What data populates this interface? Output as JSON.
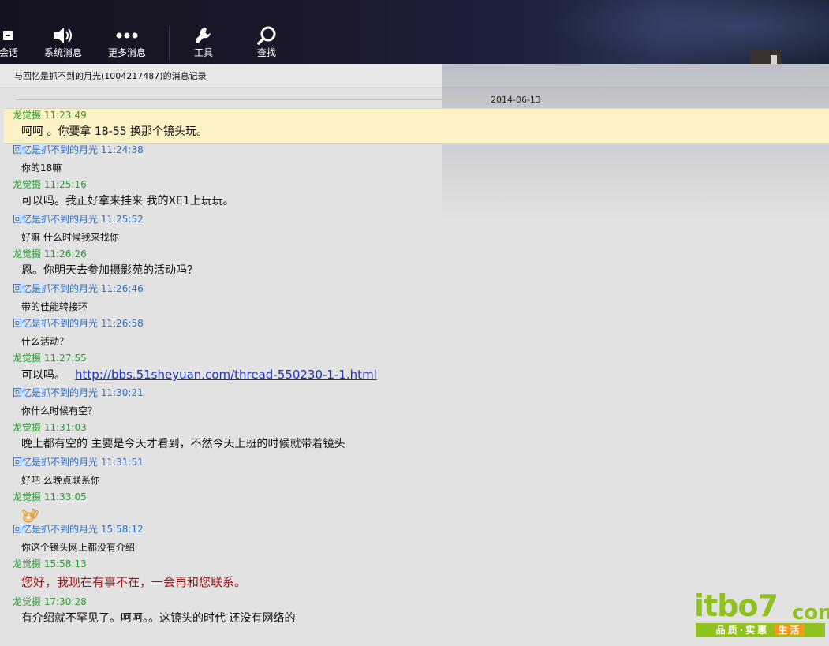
{
  "toolbar": {
    "items": [
      {
        "label": "会话",
        "icon": "chat-icon"
      },
      {
        "label": "系统消息",
        "icon": "speaker-icon"
      },
      {
        "label": "更多消息",
        "icon": "more-icon"
      },
      {
        "label": "工具",
        "icon": "wrench-icon"
      },
      {
        "label": "查找",
        "icon": "search-icon"
      }
    ]
  },
  "header": {
    "title": "与回忆是抓不到的月光(1004217487)的消息记录",
    "date": "2014-06-13"
  },
  "messages": [
    {
      "sender": "龙觉摄",
      "time": "11:23:49",
      "text": "呵呵 。你要拿 18-55 换那个镜头玩。"
    },
    {
      "sender": "回忆是抓不到的月光",
      "time": "11:24:38",
      "text": "你的18嘛"
    },
    {
      "sender": "龙觉摄",
      "time": "11:25:16",
      "text": "可以吗。我正好拿来挂来 我的XE1上玩玩。"
    },
    {
      "sender": "回忆是抓不到的月光",
      "time": "11:25:52",
      "text": "好嘛 什么时候我来找你"
    },
    {
      "sender": "龙觉摄",
      "time": "11:26:26",
      "text": "恩。你明天去参加摄影苑的活动吗？"
    },
    {
      "sender": "回忆是抓不到的月光",
      "time": "11:26:46",
      "text": "带的佳能转接环"
    },
    {
      "sender": "回忆是抓不到的月光",
      "time": "11:26:58",
      "text": "什么活动？"
    },
    {
      "sender": "龙觉摄",
      "time": "11:27:55",
      "text": "可以吗。",
      "link": "http://bbs.51sheyuan.com/thread-550230-1-1.html"
    },
    {
      "sender": "回忆是抓不到的月光",
      "time": "11:30:21",
      "text": "你什么时候有空？"
    },
    {
      "sender": "龙觉摄",
      "time": "11:31:03",
      "text": "晚上都有空的 主要是今天才看到，不然今天上班的时候就带着镜头"
    },
    {
      "sender": "回忆是抓不到的月光",
      "time": "11:31:51",
      "text": "好吧 么晚点联系你"
    },
    {
      "sender": "龙觉摄",
      "time": "11:33:05",
      "emoji": "ok-hand-emoji"
    },
    {
      "sender": "回忆是抓不到的月光",
      "time": "15:58:12",
      "text": "你这个镜头网上都没有介绍"
    },
    {
      "sender": "龙觉摄",
      "time": "15:58:13",
      "text": "您好，我现在有事不在，一会再和您联系。"
    },
    {
      "sender": "龙觉摄",
      "time": "17:30:28",
      "text": "有介绍就不罕见了。呵呵。。这镜头的时代 还没有网络的"
    }
  ],
  "watermark": {
    "brand": "itbo7",
    "domain": "com",
    "slogan_left": "品质·实惠",
    "slogan_right": "生活"
  },
  "colors": {
    "me": "#2e9b3a",
    "other": "#2a6ec7",
    "highlight": "#fdf1c6",
    "link": "#1a33c2",
    "auto_reply": "#a01616"
  }
}
